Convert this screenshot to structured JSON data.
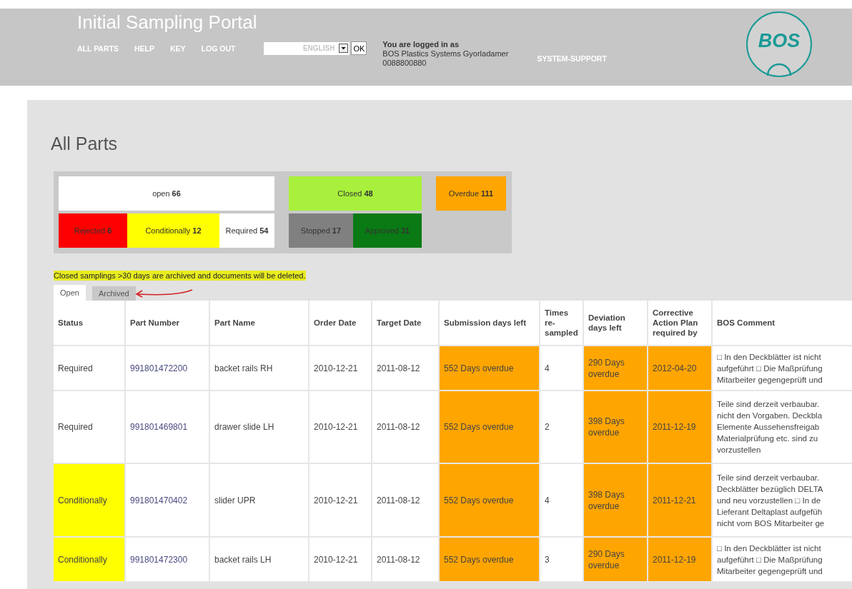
{
  "header": {
    "title": "Initial Sampling Portal",
    "nav": [
      {
        "label": "ALL PARTS"
      },
      {
        "label": "HELP"
      },
      {
        "label": "KEY"
      },
      {
        "label": "LOG OUT"
      }
    ],
    "language": {
      "value": "ENGLISH",
      "button": "OK"
    },
    "login": {
      "heading": "You are logged in as",
      "company": "BOS Plastics Systems Gyorladamer",
      "number": "0088800880"
    },
    "support_link": "SYSTEM-SUPPORT",
    "logo": "BOS"
  },
  "page_title": "All Parts",
  "summary": [
    {
      "top": {
        "label": "open",
        "count": "66",
        "color": "#ffffff"
      },
      "sub": [
        {
          "label": "Rejected",
          "count": "6",
          "color": "#ff0000"
        },
        {
          "label": "Conditionally",
          "count": "12",
          "color": "#ffff00"
        },
        {
          "label": "Required",
          "count": "54",
          "color": "#ffffff"
        }
      ]
    },
    {
      "top": {
        "label": "Closed",
        "count": "48",
        "color": "#a8f03c"
      },
      "sub": [
        {
          "label": "Stopped",
          "count": "17",
          "color": "#808080"
        },
        {
          "label": "Approved",
          "count": "31",
          "color": "#0a7a14"
        }
      ]
    },
    {
      "top": {
        "label": "Overdue",
        "count": "111",
        "color": "#ffa500"
      }
    }
  ],
  "notice": "Closed samplings >30 days are archived and documents will be deleted.",
  "tabs": [
    {
      "label": "Open",
      "selected": true
    },
    {
      "label": "Archived",
      "selected": false
    }
  ],
  "table": {
    "columns": [
      "Status",
      "Part Number",
      "Part Name",
      "Order Date",
      "Target Date",
      "Submission days left",
      "Times re-sampled",
      "Deviation days left",
      "Corrective Action Plan required by",
      "BOS Comment"
    ],
    "rows": [
      {
        "status": {
          "text": "Required",
          "kind": "required"
        },
        "part_number": "991801472200",
        "part_name": "backet rails RH",
        "order_date": "2010-12-21",
        "target_date": "2011-08-12",
        "submission": {
          "text": "552 Days overdue",
          "overdue": true
        },
        "times_resampled": "4",
        "deviation": {
          "text": "290 Days overdue",
          "overdue": true
        },
        "corrective": {
          "text": "2012-04-20",
          "overdue": true
        },
        "comment": "□ In den Deckblätter ist nicht\naufgeführt □ Die Maßprüfung\nMitarbeiter gegengeprüft und"
      },
      {
        "status": {
          "text": "Required",
          "kind": "required"
        },
        "part_number": "991801469801",
        "part_name": "drawer slide LH",
        "order_date": "2010-12-21",
        "target_date": "2011-08-12",
        "submission": {
          "text": "552 Days overdue",
          "overdue": true
        },
        "times_resampled": "2",
        "deviation": {
          "text": "398 Days overdue",
          "overdue": true
        },
        "corrective": {
          "text": "2011-12-19",
          "overdue": true
        },
        "comment": "Teile sind derzeit verbaubar.\nnicht den Vorgaben. Deckbla\nElemente Aussehensfreigab\nMaterialprüfung etc. sind zu\nvorzustellen"
      },
      {
        "status": {
          "text": "Conditionally",
          "kind": "conditionally"
        },
        "part_number": "991801470402",
        "part_name": "slider UPR",
        "order_date": "2010-12-21",
        "target_date": "2011-08-12",
        "submission": {
          "text": "552 Days overdue",
          "overdue": true
        },
        "times_resampled": "4",
        "deviation": {
          "text": "398 Days overdue",
          "overdue": true
        },
        "corrective": {
          "text": "2011-12-21",
          "overdue": true
        },
        "comment": "Teile sind derzeit verbaubar.\nDeckblätter bezüglich DELTA\nund neu vorzustellen □ In de\nLieferant Deltaplast aufgefüh\nnicht vom BOS Mitarbeiter ge"
      },
      {
        "status": {
          "text": "Conditionally",
          "kind": "conditionally"
        },
        "part_number": "991801472300",
        "part_name": "backet rails LH",
        "order_date": "2010-12-21",
        "target_date": "2011-08-12",
        "submission": {
          "text": "552 Days overdue",
          "overdue": true
        },
        "times_resampled": "3",
        "deviation": {
          "text": "290 Days overdue",
          "overdue": true
        },
        "corrective": {
          "text": "2011-12-19",
          "overdue": true
        },
        "comment": "□ In den Deckblätter ist nicht\naufgeführt □ Die Maßprüfung\nMitarbeiter gegengeprüft und"
      }
    ]
  }
}
